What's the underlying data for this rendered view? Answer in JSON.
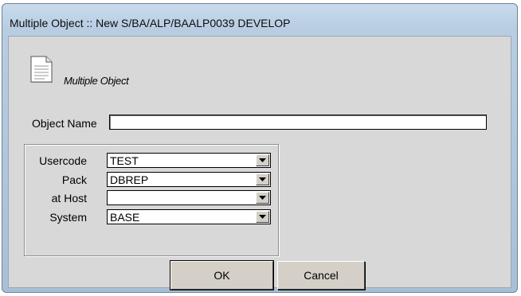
{
  "window": {
    "title": "Multiple Object :: New S/BA/ALP/BAALP0039 DEVELOP"
  },
  "header": {
    "icon": "document-icon",
    "caption": "Multiple Object"
  },
  "object_name": {
    "label": "Object Name",
    "value": ""
  },
  "fields": [
    {
      "label": "Usercode",
      "value": "TEST"
    },
    {
      "label": "Pack",
      "value": "DBREP"
    },
    {
      "label": "at Host",
      "value": ""
    },
    {
      "label": "System",
      "value": "BASE"
    }
  ],
  "buttons": {
    "ok_label": "OK",
    "cancel_label": "Cancel"
  }
}
